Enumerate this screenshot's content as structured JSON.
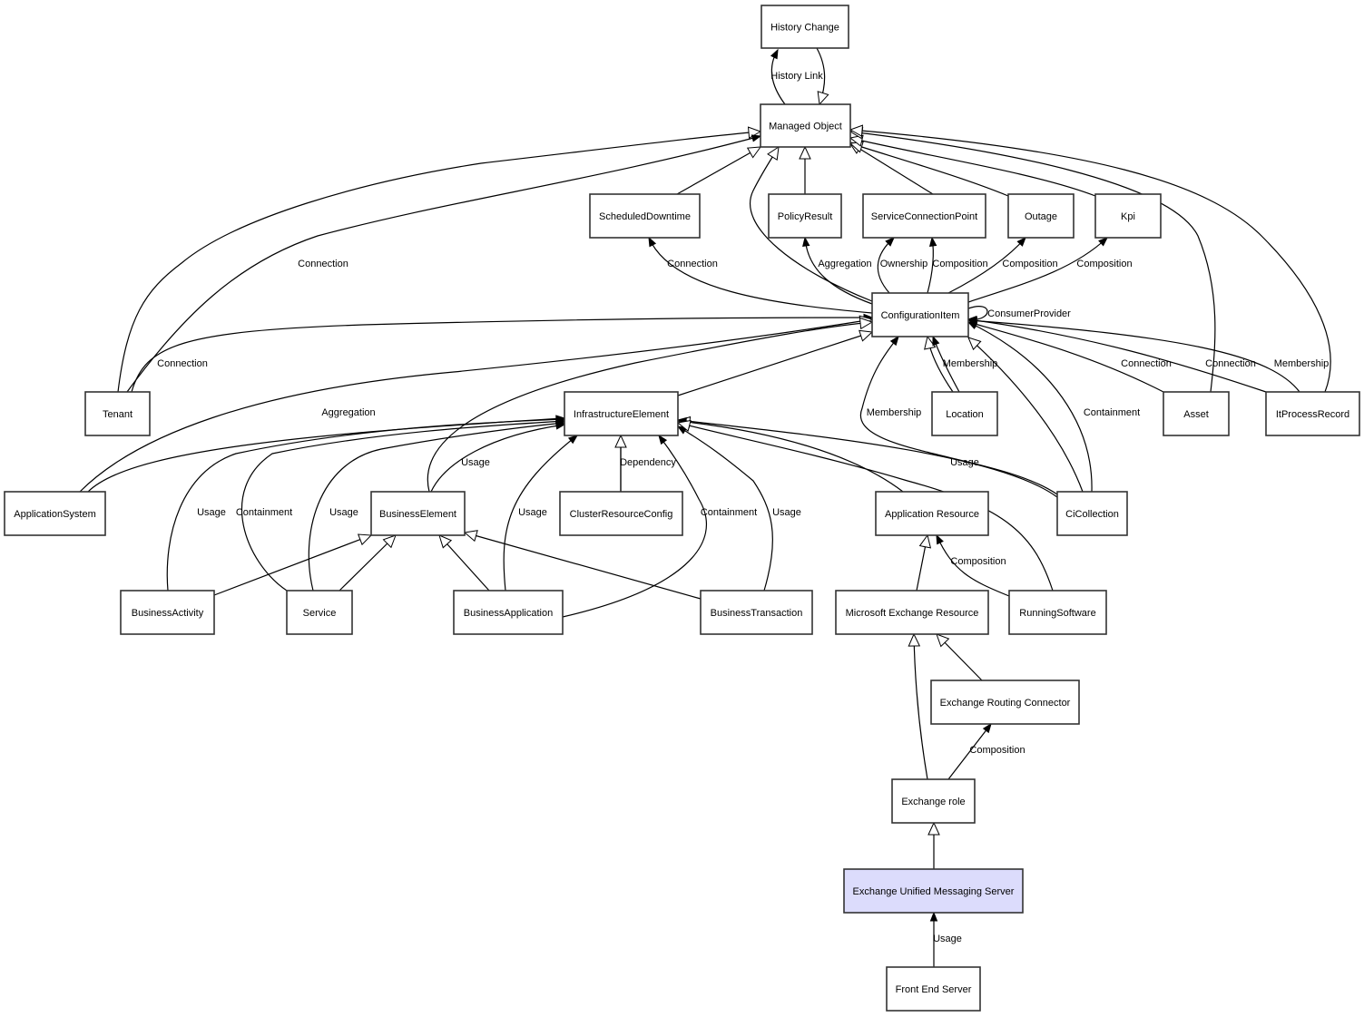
{
  "diagram": {
    "type": "class-relationship-graph",
    "highlight_color": "#dcdcfc",
    "nodes": [
      {
        "id": "history_change",
        "label": "History Change"
      },
      {
        "id": "managed_object",
        "label": "Managed Object"
      },
      {
        "id": "scheduled_downtime",
        "label": "ScheduledDowntime"
      },
      {
        "id": "policy_result",
        "label": "PolicyResult"
      },
      {
        "id": "service_connection_point",
        "label": "ServiceConnectionPoint"
      },
      {
        "id": "outage",
        "label": "Outage"
      },
      {
        "id": "kpi",
        "label": "Kpi"
      },
      {
        "id": "configuration_item",
        "label": "ConfigurationItem"
      },
      {
        "id": "tenant",
        "label": "Tenant"
      },
      {
        "id": "infrastructure_element",
        "label": "InfrastructureElement"
      },
      {
        "id": "location",
        "label": "Location"
      },
      {
        "id": "asset",
        "label": "Asset"
      },
      {
        "id": "it_process_record",
        "label": "ItProcessRecord"
      },
      {
        "id": "application_system",
        "label": "ApplicationSystem"
      },
      {
        "id": "business_element",
        "label": "BusinessElement"
      },
      {
        "id": "cluster_resource_config",
        "label": "ClusterResourceConfig"
      },
      {
        "id": "application_resource",
        "label": "Application Resource"
      },
      {
        "id": "ci_collection",
        "label": "CiCollection"
      },
      {
        "id": "business_activity",
        "label": "BusinessActivity"
      },
      {
        "id": "service",
        "label": "Service"
      },
      {
        "id": "business_application",
        "label": "BusinessApplication"
      },
      {
        "id": "business_transaction",
        "label": "BusinessTransaction"
      },
      {
        "id": "ms_exchange_resource",
        "label": "Microsoft Exchange Resource"
      },
      {
        "id": "running_software",
        "label": "RunningSoftware"
      },
      {
        "id": "exchange_routing_connector",
        "label": "Exchange Routing Connector"
      },
      {
        "id": "exchange_role",
        "label": "Exchange role"
      },
      {
        "id": "exchange_um_server",
        "label": "Exchange Unified Messaging Server",
        "highlighted": true
      },
      {
        "id": "front_end_server",
        "label": "Front End Server"
      }
    ],
    "edges": [
      {
        "from": "managed_object",
        "to": "history_change",
        "label": "History Link",
        "kind": "association"
      },
      {
        "from": "history_change",
        "to": "managed_object",
        "label": "",
        "kind": "inheritance"
      },
      {
        "from": "scheduled_downtime",
        "to": "managed_object",
        "label": "",
        "kind": "inheritance"
      },
      {
        "from": "policy_result",
        "to": "managed_object",
        "label": "",
        "kind": "inheritance"
      },
      {
        "from": "service_connection_point",
        "to": "managed_object",
        "label": "",
        "kind": "inheritance"
      },
      {
        "from": "outage",
        "to": "managed_object",
        "label": "",
        "kind": "inheritance"
      },
      {
        "from": "kpi",
        "to": "managed_object",
        "label": "",
        "kind": "inheritance"
      },
      {
        "from": "configuration_item",
        "to": "managed_object",
        "label": "",
        "kind": "inheritance"
      },
      {
        "from": "tenant",
        "to": "managed_object",
        "label": "",
        "kind": "inheritance"
      },
      {
        "from": "tenant",
        "to": "managed_object",
        "label": "Connection",
        "kind": "association"
      },
      {
        "from": "asset",
        "to": "managed_object",
        "label": "",
        "kind": "inheritance"
      },
      {
        "from": "it_process_record",
        "to": "managed_object",
        "label": "",
        "kind": "inheritance"
      },
      {
        "from": "configuration_item",
        "to": "scheduled_downtime",
        "label": "Connection",
        "kind": "association"
      },
      {
        "from": "configuration_item",
        "to": "policy_result",
        "label": "Aggregation",
        "kind": "association"
      },
      {
        "from": "configuration_item",
        "to": "service_connection_point",
        "label": "Ownership",
        "kind": "association"
      },
      {
        "from": "configuration_item",
        "to": "service_connection_point",
        "label": "Composition",
        "kind": "association"
      },
      {
        "from": "configuration_item",
        "to": "outage",
        "label": "Composition",
        "kind": "association"
      },
      {
        "from": "configuration_item",
        "to": "kpi",
        "label": "Composition",
        "kind": "association"
      },
      {
        "from": "configuration_item",
        "to": "configuration_item",
        "label": "ConsumerProvider",
        "kind": "association"
      },
      {
        "from": "tenant",
        "to": "configuration_item",
        "label": "Connection",
        "kind": "association"
      },
      {
        "from": "application_system",
        "to": "configuration_item",
        "label": "",
        "kind": "inheritance"
      },
      {
        "from": "business_element",
        "to": "configuration_item",
        "label": "",
        "kind": "inheritance"
      },
      {
        "from": "infrastructure_element",
        "to": "configuration_item",
        "label": "",
        "kind": "inheritance"
      },
      {
        "from": "location",
        "to": "configuration_item",
        "label": "",
        "kind": "inheritance"
      },
      {
        "from": "location",
        "to": "configuration_item",
        "label": "Membership",
        "kind": "association"
      },
      {
        "from": "ci_collection",
        "to": "configuration_item",
        "label": "Membership",
        "kind": "association"
      },
      {
        "from": "ci_collection",
        "to": "configuration_item",
        "label": "",
        "kind": "inheritance"
      },
      {
        "from": "ci_collection",
        "to": "configuration_item",
        "label": "Containment",
        "kind": "association"
      },
      {
        "from": "asset",
        "to": "configuration_item",
        "label": "Connection",
        "kind": "association"
      },
      {
        "from": "it_process_record",
        "to": "configuration_item",
        "label": "Connection",
        "kind": "association"
      },
      {
        "from": "it_process_record",
        "to": "configuration_item",
        "label": "Membership",
        "kind": "association"
      },
      {
        "from": "application_system",
        "to": "infrastructure_element",
        "label": "Aggregation",
        "kind": "association"
      },
      {
        "from": "business_activity",
        "to": "infrastructure_element",
        "label": "Usage",
        "kind": "association"
      },
      {
        "from": "service",
        "to": "infrastructure_element",
        "label": "Containment",
        "kind": "association"
      },
      {
        "from": "service",
        "to": "infrastructure_element",
        "label": "Usage",
        "kind": "association"
      },
      {
        "from": "business_element",
        "to": "infrastructure_element",
        "label": "Usage",
        "kind": "association"
      },
      {
        "from": "business_application",
        "to": "infrastructure_element",
        "label": "Usage",
        "kind": "association"
      },
      {
        "from": "cluster_resource_config",
        "to": "infrastructure_element",
        "label": "Dependency",
        "kind": "association"
      },
      {
        "from": "business_application",
        "to": "infrastructure_element",
        "label": "Containment",
        "kind": "association"
      },
      {
        "from": "business_transaction",
        "to": "infrastructure_element",
        "label": "Usage",
        "kind": "association"
      },
      {
        "from": "application_resource",
        "to": "infrastructure_element",
        "label": "",
        "kind": "inheritance"
      },
      {
        "from": "ci_collection",
        "to": "infrastructure_element",
        "label": "Usage",
        "kind": "association"
      },
      {
        "from": "running_software",
        "to": "infrastructure_element",
        "label": "",
        "kind": "inheritance"
      },
      {
        "from": "cluster_resource_config",
        "to": "infrastructure_element",
        "label": "",
        "kind": "inheritance"
      },
      {
        "from": "business_activity",
        "to": "business_element",
        "label": "",
        "kind": "inheritance"
      },
      {
        "from": "service",
        "to": "business_element",
        "label": "",
        "kind": "inheritance"
      },
      {
        "from": "business_application",
        "to": "business_element",
        "label": "",
        "kind": "inheritance"
      },
      {
        "from": "business_transaction",
        "to": "business_element",
        "label": "",
        "kind": "inheritance"
      },
      {
        "from": "ms_exchange_resource",
        "to": "application_resource",
        "label": "",
        "kind": "inheritance"
      },
      {
        "from": "running_software",
        "to": "application_resource",
        "label": "Composition",
        "kind": "association"
      },
      {
        "from": "exchange_routing_connector",
        "to": "ms_exchange_resource",
        "label": "",
        "kind": "inheritance"
      },
      {
        "from": "exchange_role",
        "to": "ms_exchange_resource",
        "label": "",
        "kind": "inheritance"
      },
      {
        "from": "exchange_role",
        "to": "exchange_routing_connector",
        "label": "Composition",
        "kind": "association"
      },
      {
        "from": "exchange_um_server",
        "to": "exchange_role",
        "label": "",
        "kind": "inheritance"
      },
      {
        "from": "front_end_server",
        "to": "exchange_um_server",
        "label": "Usage",
        "kind": "association"
      }
    ]
  }
}
